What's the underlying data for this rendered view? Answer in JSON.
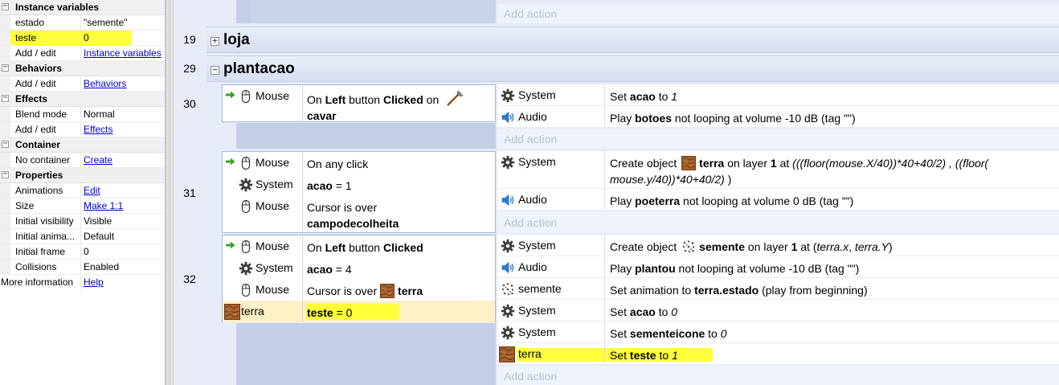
{
  "props": {
    "sections": {
      "instance_vars": "Instance variables",
      "behaviors": "Behaviors",
      "effects": "Effects",
      "container": "Container",
      "properties": "Properties"
    },
    "rows": {
      "estado": {
        "name": "estado",
        "value": "\"semente\""
      },
      "teste": {
        "name": "teste",
        "value": "0"
      },
      "addedit_iv": {
        "name": "Add / edit",
        "value": "Instance variables"
      },
      "addedit_beh": {
        "name": "Add / edit",
        "value": "Behaviors"
      },
      "blend": {
        "name": "Blend mode",
        "value": "Normal"
      },
      "addedit_eff": {
        "name": "Add / edit",
        "value": "Effects"
      },
      "nocontainer": {
        "name": "No container",
        "value": "Create"
      },
      "animations": {
        "name": "Animations",
        "value": "Edit"
      },
      "size": {
        "name": "Size",
        "value": "Make 1:1"
      },
      "visibility": {
        "name": "Initial visibility",
        "value": "Visible"
      },
      "initanim": {
        "name": "Initial anima...",
        "value": "Default"
      },
      "initframe": {
        "name": "Initial frame",
        "value": "0"
      },
      "collisions": {
        "name": "Collisions",
        "value": "Enabled"
      },
      "moreinfo": {
        "name": "More information",
        "value": "Help"
      }
    }
  },
  "sheet": {
    "add_action": "Add action",
    "groups": {
      "loja": {
        "line": "19",
        "title": "loja"
      },
      "plantacao": {
        "line": "29",
        "title": "plantacao"
      }
    },
    "events": {
      "e30": {
        "line": "30",
        "conds": [
          {
            "obj": "Mouse",
            "pre": "On ",
            "b1": "Left",
            "mid": " button ",
            "b2": "Clicked",
            "post": " on",
            "b3": "cavar"
          }
        ],
        "acts": [
          {
            "obj": "System",
            "pre": "Set ",
            "b1": "acao",
            "mid": " to ",
            "i1": "1"
          },
          {
            "obj": "Audio",
            "pre": "Play ",
            "b1": "botoes",
            "post": " not looping at volume -10 dB (tag \"\")"
          }
        ]
      },
      "e31": {
        "line": "31",
        "conds": [
          {
            "obj": "Mouse",
            "text": "On any click"
          },
          {
            "obj": "System",
            "b1": "acao",
            "post": " = 1"
          },
          {
            "obj": "Mouse",
            "pre": "Cursor is over",
            "b1": "campodecolheita"
          }
        ],
        "acts": [
          {
            "obj": "System",
            "pre": "Create object ",
            "b1": "terra",
            "mid": " on layer ",
            "b2": "1",
            "post": " at ",
            "i1": "(((floor(mouse.X/40))*40+40/2)   , ((floor(",
            "i2": "mouse.y/40))*40+40/2)",
            "end": "  )"
          },
          {
            "obj": "Audio",
            "pre": "Play ",
            "b1": "poeterra",
            "post": " not looping at volume 0 dB (tag \"\")"
          }
        ]
      },
      "e32": {
        "line": "32",
        "conds": [
          {
            "obj": "Mouse",
            "pre": "On ",
            "b1": "Left",
            "mid": " button ",
            "b2": "Clicked"
          },
          {
            "obj": "System",
            "b1": "acao",
            "post": " = 4"
          },
          {
            "obj": "Mouse",
            "pre": "Cursor is over ",
            "b1": "terra"
          },
          {
            "obj": "terra",
            "b1": "teste",
            "post": " = 0"
          }
        ],
        "acts": [
          {
            "obj": "System",
            "pre": "Create object ",
            "b1": "semente",
            "mid": " on layer ",
            "b2": "1",
            "post": " at (",
            "i1": "terra.x",
            "mid2": ", ",
            "i2": "terra.Y",
            "end": ")"
          },
          {
            "obj": "Audio",
            "pre": "Play ",
            "b1": "plantou",
            "post": " not looping at volume -10 dB (tag \"\")"
          },
          {
            "obj": "semente",
            "pre": "Set animation to ",
            "b1": "terra.estado",
            "post": " (play from beginning)"
          },
          {
            "obj": "System",
            "pre": "Set ",
            "b1": "acao",
            "mid": " to ",
            "i1": "0"
          },
          {
            "obj": "System",
            "pre": "Set ",
            "b1": "sementeicone",
            "mid": " to ",
            "i1": "0"
          },
          {
            "obj": "terra",
            "pre": "Set ",
            "b1": "teste",
            "mid": " to ",
            "i1": "1"
          }
        ]
      }
    }
  },
  "colors": {
    "highlight": "#ffff3b",
    "group_bg": "#d6dff0",
    "link": "#0000cc"
  }
}
